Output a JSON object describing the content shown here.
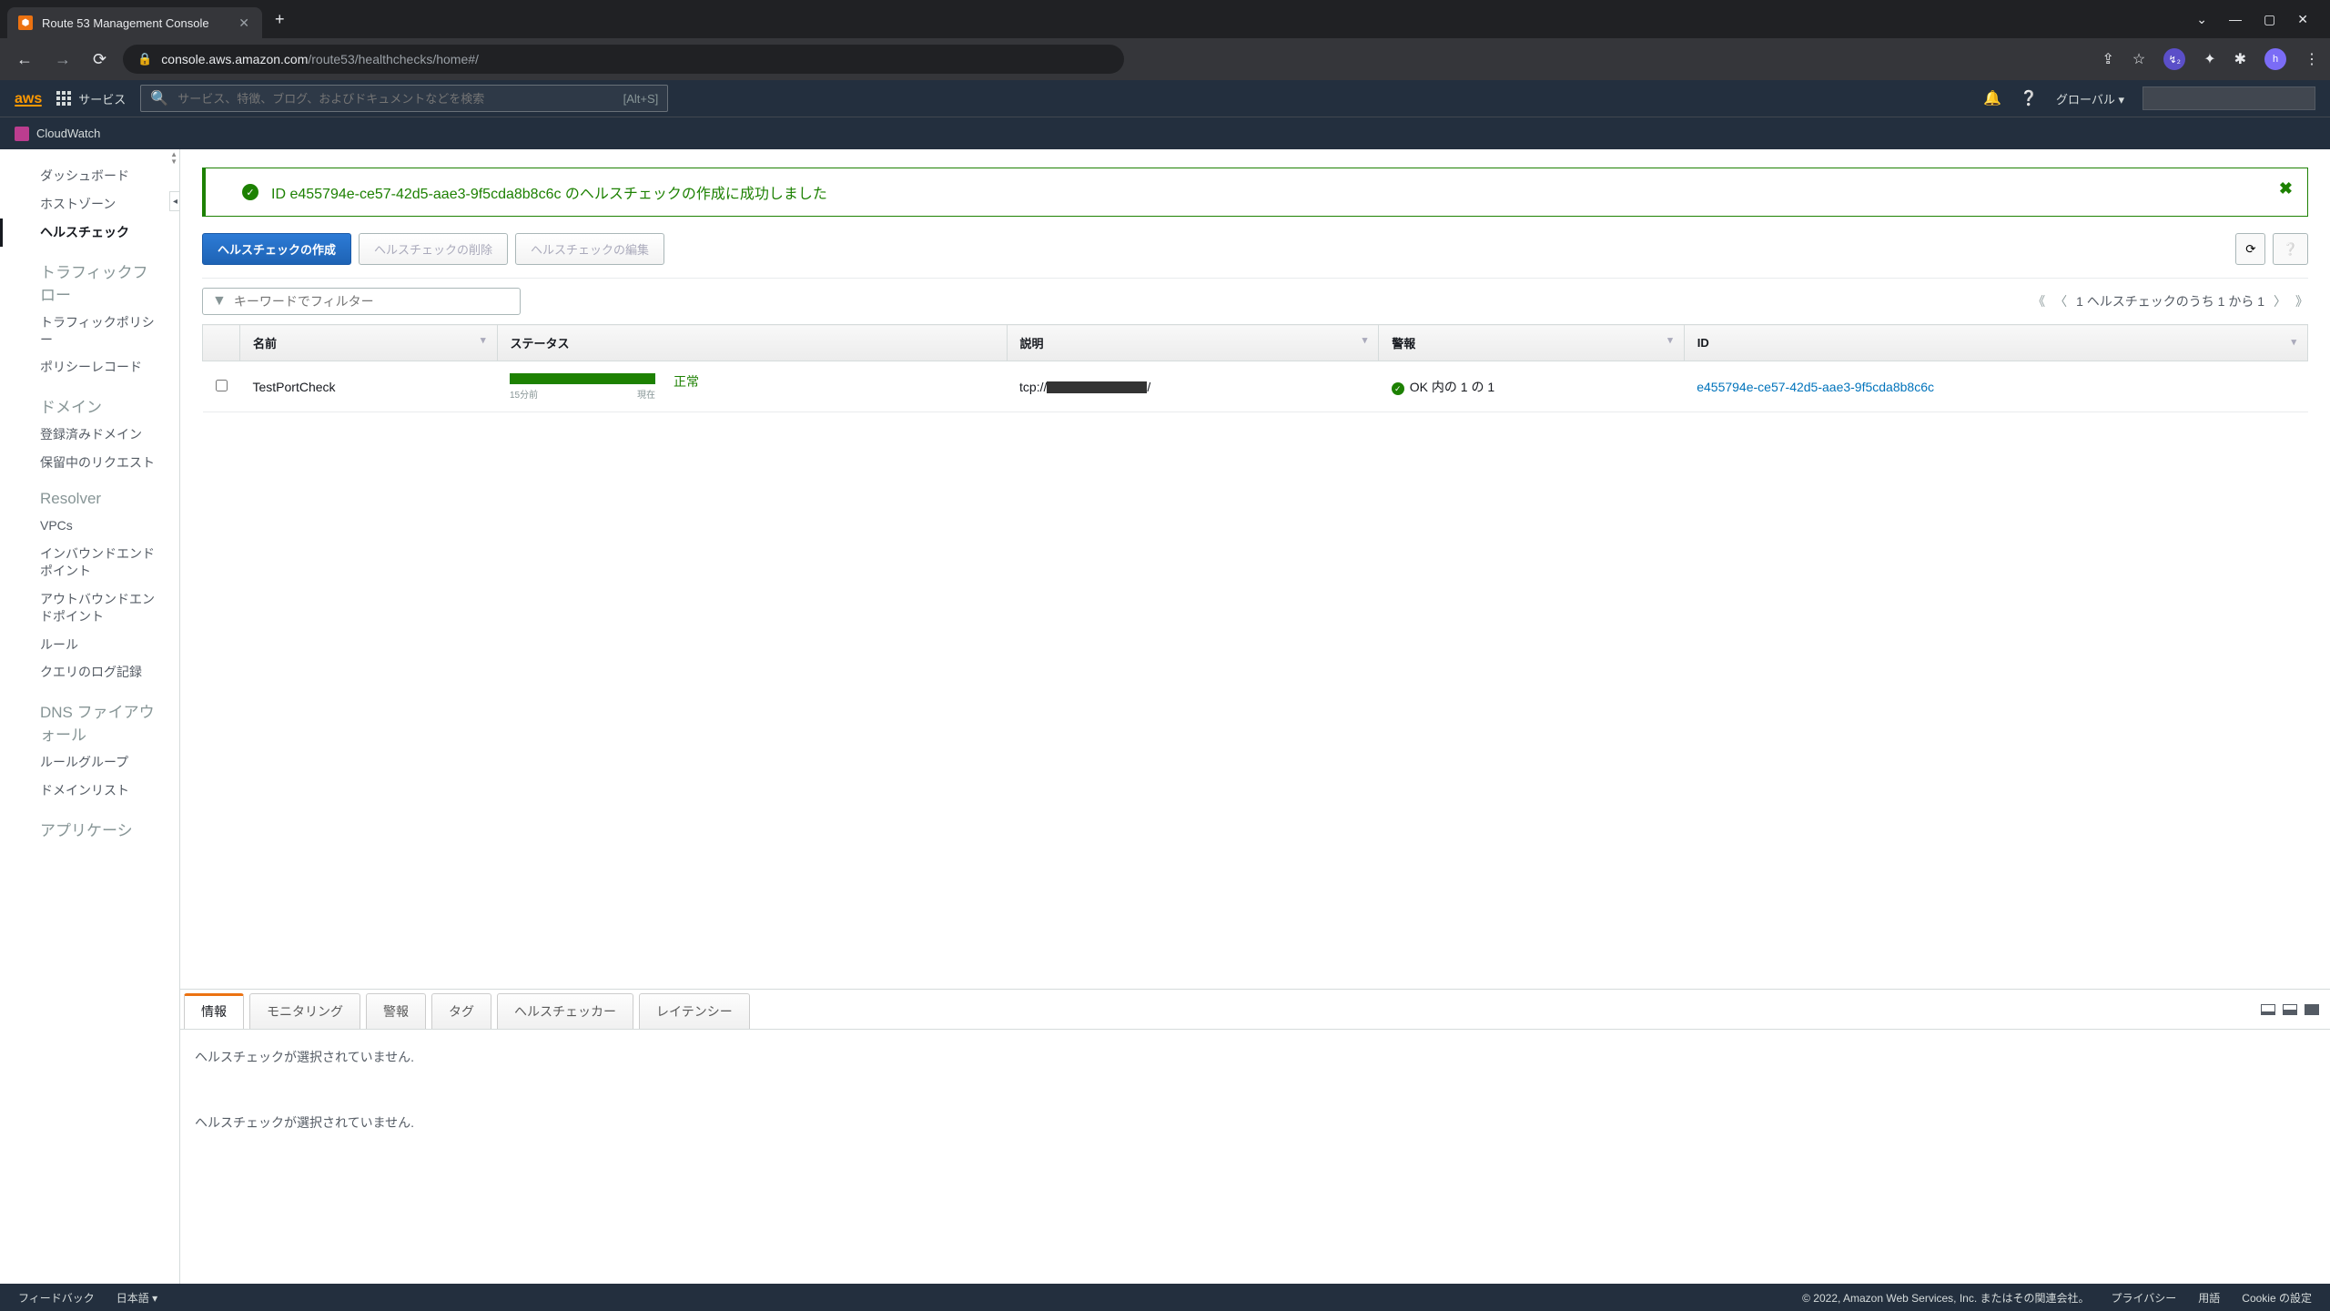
{
  "browser": {
    "tab_title": "Route 53 Management Console",
    "url_domain": "console.aws.amazon.com",
    "url_path": "/route53/healthchecks/home#/"
  },
  "aws_header": {
    "services": "サービス",
    "search_placeholder": "サービス、特徴、ブログ、およびドキュメントなどを検索",
    "search_shortcut": "[Alt+S]",
    "region": "グローバル ▾",
    "cloudwatch": "CloudWatch"
  },
  "sidebar": {
    "items": [
      "ダッシュボード",
      "ホストゾーン",
      "ヘルスチェック"
    ],
    "traffic_flow_header": "トラフィックフロー",
    "traffic_flow": [
      "トラフィックポリシー",
      "ポリシーレコード"
    ],
    "domain_header": "ドメイン",
    "domains": [
      "登録済みドメイン",
      "保留中のリクエスト"
    ],
    "resolver_header": "Resolver",
    "resolver": [
      "VPCs",
      "インバウンドエンドポイント",
      "アウトバウンドエンドポイント",
      "ルール",
      "クエリのログ記録"
    ],
    "firewall_header": "DNS ファイアウォール",
    "firewall": [
      "ルールグループ",
      "ドメインリスト"
    ],
    "app_header": "アプリケーシ"
  },
  "alert": {
    "text": "ID e455794e-ce57-42d5-aae3-9f5cda8b8c6c のヘルスチェックの作成に成功しました"
  },
  "actions": {
    "create": "ヘルスチェックの作成",
    "delete": "ヘルスチェックの削除",
    "edit": "ヘルスチェックの編集"
  },
  "filter_placeholder": "キーワードでフィルター",
  "pagination_text": "1 ヘルスチェックのうち 1 から 1",
  "table": {
    "headers": {
      "name": "名前",
      "status": "ステータス",
      "description": "説明",
      "alarm": "警報",
      "id": "ID"
    },
    "row": {
      "name": "TestPortCheck",
      "status_from": "15分前",
      "status_to": "現在",
      "status_text": "正常",
      "description_prefix": "tcp://",
      "description_suffix": "/",
      "alarm": "OK 内の 1 の 1",
      "id": "e455794e-ce57-42d5-aae3-9f5cda8b8c6c"
    }
  },
  "panel": {
    "tabs": [
      "情報",
      "モニタリング",
      "警報",
      "タグ",
      "ヘルスチェッカー",
      "レイテンシー"
    ],
    "empty1": "ヘルスチェックが選択されていません.",
    "empty2": "ヘルスチェックが選択されていません."
  },
  "footer": {
    "feedback": "フィードバック",
    "language": "日本語 ▾",
    "copyright": "© 2022, Amazon Web Services, Inc. またはその関連会社。",
    "privacy": "プライバシー",
    "terms": "用語",
    "cookies": "Cookie の設定"
  }
}
